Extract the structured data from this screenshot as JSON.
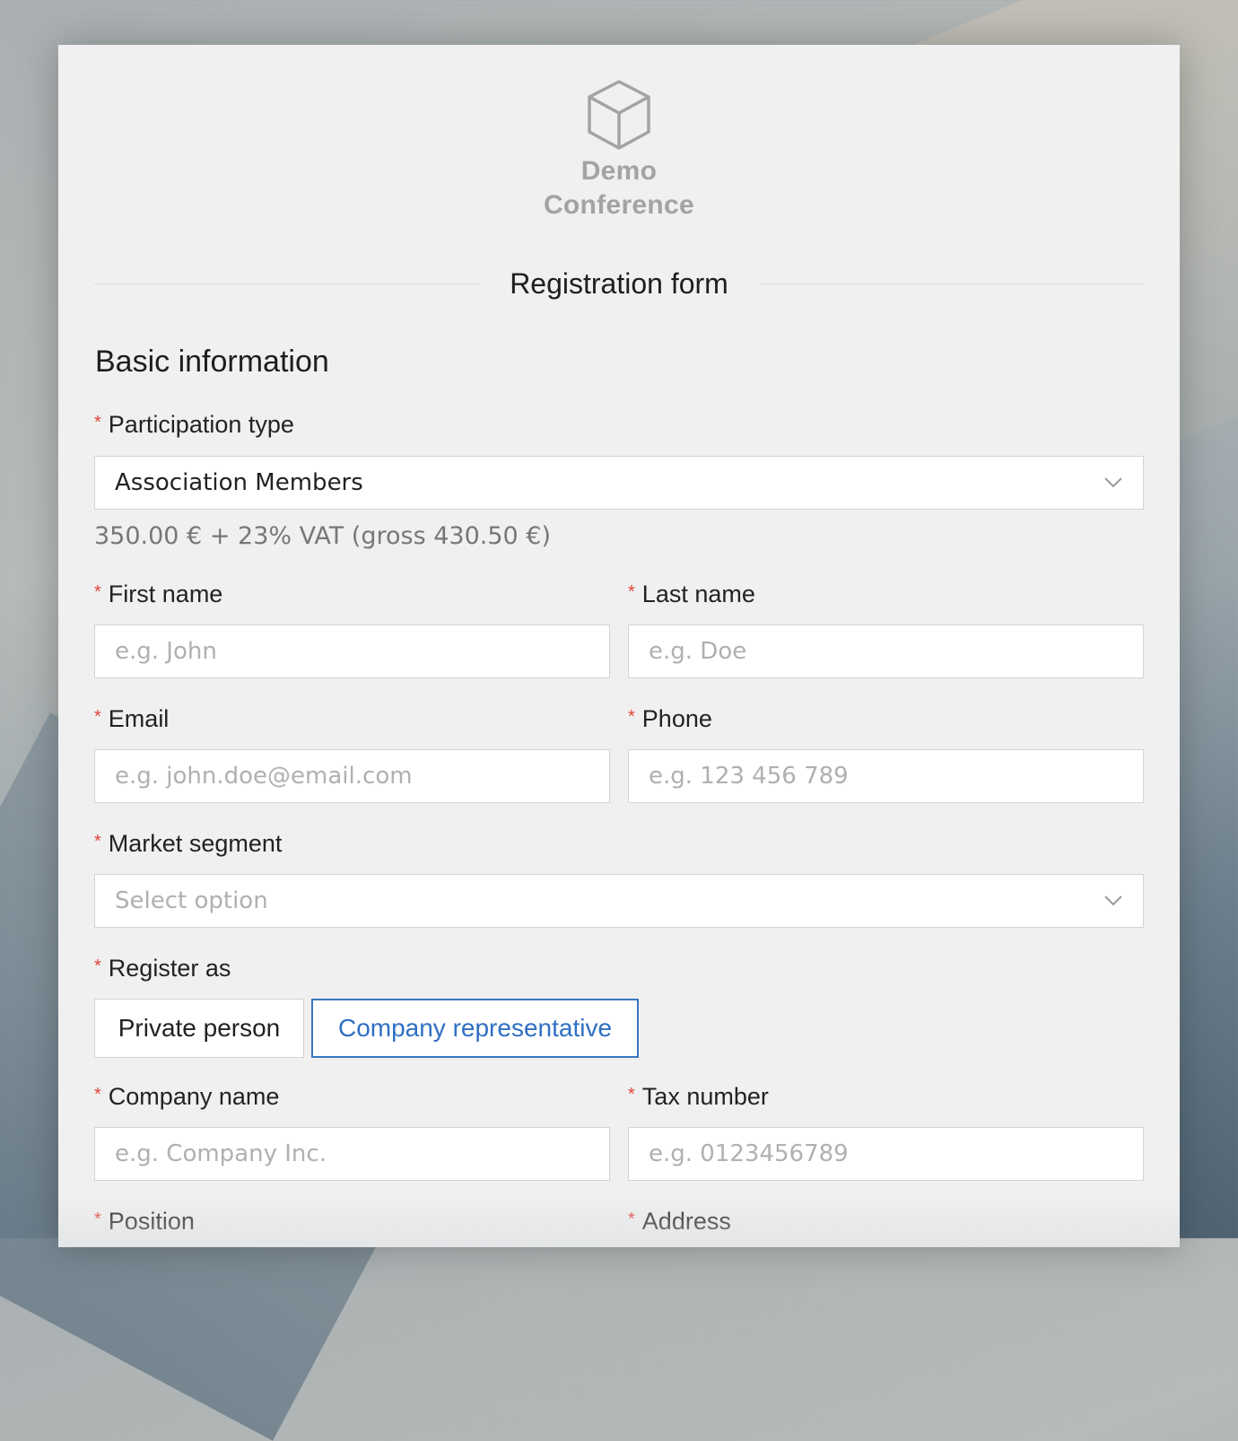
{
  "logo": {
    "line1": "Demo",
    "line2": "Conference",
    "icon": "cube-icon"
  },
  "form": {
    "title": "Registration form",
    "section_title": "Basic information",
    "required_mark": "*",
    "participation_type": {
      "label": "Participation type",
      "value": "Association Members"
    },
    "price_note": "350.00 € + 23% VAT (gross 430.50 €)",
    "first_name": {
      "label": "First name",
      "placeholder": "e.g. John"
    },
    "last_name": {
      "label": "Last name",
      "placeholder": "e.g. Doe"
    },
    "email": {
      "label": "Email",
      "placeholder": "e.g. john.doe@email.com"
    },
    "phone": {
      "label": "Phone",
      "placeholder": "e.g. 123 456 789"
    },
    "market_segment": {
      "label": "Market segment",
      "placeholder": "Select option"
    },
    "register_as": {
      "label": "Register as",
      "options": [
        "Private person",
        "Company representative"
      ],
      "selected": "Company representative"
    },
    "company_name": {
      "label": "Company name",
      "placeholder": "e.g. Company Inc."
    },
    "tax_number": {
      "label": "Tax number",
      "placeholder": "e.g. 0123456789"
    },
    "position": {
      "label": "Position"
    },
    "address": {
      "label": "Address"
    }
  },
  "colors": {
    "required": "#e0453a",
    "accent": "#3a76c4",
    "card": "#f0f0f0"
  }
}
